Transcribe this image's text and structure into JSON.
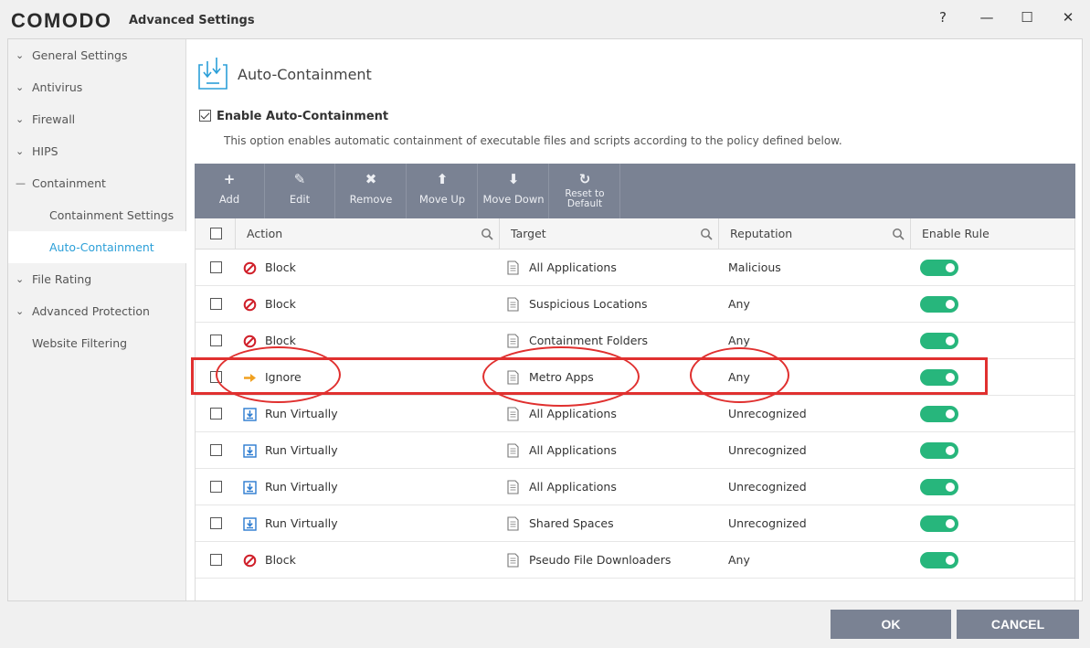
{
  "window": {
    "brand": "COMODO",
    "title": "Advanced Settings",
    "help": "?",
    "minimize": "—",
    "maximize": "☐",
    "close": "✕"
  },
  "sidebar": {
    "items": [
      {
        "label": "General Settings",
        "chev": "⌄"
      },
      {
        "label": "Antivirus",
        "chev": "⌄"
      },
      {
        "label": "Firewall",
        "chev": "⌄"
      },
      {
        "label": "HIPS",
        "chev": "⌄"
      },
      {
        "label": "Containment",
        "chev": "—"
      },
      {
        "label": "Containment Settings"
      },
      {
        "label": "Auto-Containment"
      },
      {
        "label": "File Rating",
        "chev": "⌄"
      },
      {
        "label": "Advanced Protection",
        "chev": "⌄"
      },
      {
        "label": "Website Filtering"
      }
    ]
  },
  "section": {
    "title": "Auto-Containment",
    "enable_label": "Enable Auto-Containment",
    "description": "This option enables automatic containment of executable files and scripts according to the policy defined below."
  },
  "toolbar": {
    "buttons": [
      {
        "icon": "+",
        "label": "Add"
      },
      {
        "icon": "✎",
        "label": "Edit"
      },
      {
        "icon": "✖",
        "label": "Remove"
      },
      {
        "icon": "⬆",
        "label": "Move Up"
      },
      {
        "icon": "⬇",
        "label": "Move Down"
      },
      {
        "icon": "↻",
        "label": "Reset to Default"
      }
    ]
  },
  "table": {
    "headers": {
      "action": "Action",
      "target": "Target",
      "reputation": "Reputation",
      "enable": "Enable Rule"
    },
    "rows": [
      {
        "action": "Block",
        "action_icon": "block-icon",
        "target": "All Applications",
        "reputation": "Malicious",
        "enabled": true
      },
      {
        "action": "Block",
        "action_icon": "block-icon",
        "target": "Suspicious Locations",
        "reputation": "Any",
        "enabled": true
      },
      {
        "action": "Block",
        "action_icon": "block-icon",
        "target": "Containment Folders",
        "reputation": "Any",
        "enabled": true
      },
      {
        "action": "Ignore",
        "action_icon": "arrow-right-icon",
        "target": "Metro Apps",
        "reputation": "Any",
        "enabled": true
      },
      {
        "action": "Run Virtually",
        "action_icon": "run-virtually-icon",
        "target": "All Applications",
        "reputation": "Unrecognized",
        "enabled": true
      },
      {
        "action": "Run Virtually",
        "action_icon": "run-virtually-icon",
        "target": "All Applications",
        "reputation": "Unrecognized",
        "enabled": true
      },
      {
        "action": "Run Virtually",
        "action_icon": "run-virtually-icon",
        "target": "All Applications",
        "reputation": "Unrecognized",
        "enabled": true
      },
      {
        "action": "Run Virtually",
        "action_icon": "run-virtually-icon",
        "target": "Shared Spaces",
        "reputation": "Unrecognized",
        "enabled": true
      },
      {
        "action": "Block",
        "action_icon": "block-icon",
        "target": "Pseudo File Downloaders",
        "reputation": "Any",
        "enabled": true
      }
    ]
  },
  "footer": {
    "ok": "OK",
    "cancel": "CANCEL"
  },
  "colors": {
    "accent": "#2b9fd8",
    "toolbar": "#7a8293",
    "toggle_on": "#27b67c",
    "annotation": "#e0302f",
    "block": "#d0202a",
    "ignore": "#f0a020"
  }
}
